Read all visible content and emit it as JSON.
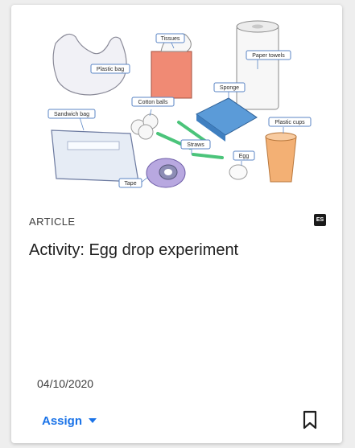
{
  "card": {
    "illustration": {
      "labels": {
        "tissues": "Tissues",
        "plastic_bag": "Plastic bag",
        "paper_towels": "Paper towels",
        "sponge": "Sponge",
        "cotton_balls": "Cotton balls",
        "sandwich_bag": "Sandwich bag",
        "plastic_cups": "Plastic cups",
        "straws": "Straws",
        "egg": "Egg",
        "tape": "Tape"
      }
    },
    "type_label": "ARTICLE",
    "grade_badge": "ES",
    "title": "Activity: Egg drop experiment",
    "date": "04/10/2020",
    "assign_label": "Assign",
    "icons": {
      "assign_dropdown": "chevron-down-icon",
      "bookmark": "bookmark-icon"
    },
    "colors": {
      "accent": "#1a73e8",
      "text": "#1f1f1f"
    }
  }
}
